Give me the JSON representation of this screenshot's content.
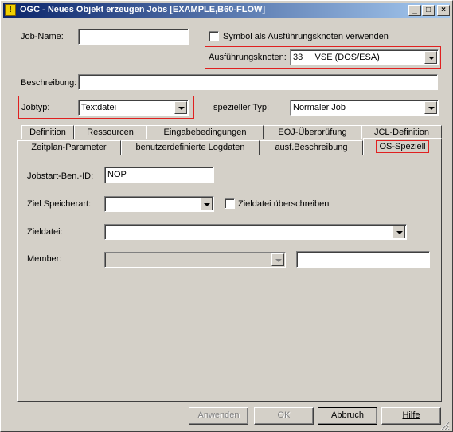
{
  "window": {
    "title": "OGC - Neues Objekt erzeugen Jobs [EXAMPLE,B60-FLOW]",
    "minimize": "_",
    "maximize": "□",
    "close": "×",
    "app_icon": "!"
  },
  "form": {
    "job_name_label": "Job-Name:",
    "job_name_value": "",
    "symbol_checkbox_label": "Symbol als Ausführungsknoten verwenden",
    "symbol_checked": false,
    "exec_node_label": "Ausführungsknoten:",
    "exec_node_value": "33     VSE (DOS/ESA)",
    "description_label": "Beschreibung:",
    "description_value": "",
    "job_type_label": "Jobtyp:",
    "job_type_value": "Textdatei",
    "special_type_label": "spezieller Typ:",
    "special_type_value": "Normaler Job"
  },
  "tabs": {
    "row1": [
      "Definition",
      "Ressourcen",
      "Eingabebedingungen",
      "EOJ-Überprüfung",
      "JCL-Definition"
    ],
    "row2": [
      "Zeitplan-Parameter",
      "benutzerdefinierte Logdaten",
      "ausf.Beschreibung",
      "OS-Speziell"
    ],
    "active": "OS-Speziell"
  },
  "panel": {
    "jobstart_label": "Jobstart-Ben.-ID:",
    "jobstart_value": "NOP",
    "storage_label": "Ziel Speicherart:",
    "storage_value": "",
    "overwrite_label": "Zieldatei überschreiben",
    "overwrite_checked": false,
    "target_file_label": "Zieldatei:",
    "target_file_value": "",
    "member_label": "Member:",
    "member_value": "",
    "member_text": ""
  },
  "buttons": {
    "apply": "Anwenden",
    "ok": "OK",
    "cancel": "Abbruch",
    "help": "Hilfe"
  },
  "colors": {
    "highlight_red": "#e02020",
    "title_start": "#0a246a",
    "title_end": "#a6caf0"
  }
}
